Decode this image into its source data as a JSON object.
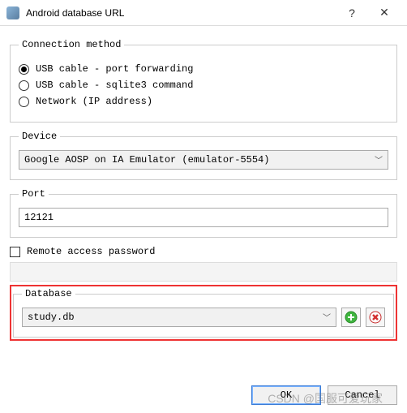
{
  "window": {
    "title": "Android database URL",
    "help": "?",
    "close": "✕"
  },
  "connection": {
    "legend": "Connection method",
    "options": [
      "USB cable - port forwarding",
      "USB cable - sqlite3 command",
      "Network (IP address)"
    ],
    "selected_index": 0
  },
  "device": {
    "legend": "Device",
    "value": "Google AOSP on IA Emulator (emulator-5554)"
  },
  "port": {
    "legend": "Port",
    "value": "12121"
  },
  "remote_pw": {
    "label": "Remote access password",
    "checked": false,
    "value": ""
  },
  "database": {
    "legend": "Database",
    "value": "study.db"
  },
  "buttons": {
    "ok": "OK",
    "cancel": "Cancel"
  },
  "watermark": "CSDN @国服可爱玩家"
}
